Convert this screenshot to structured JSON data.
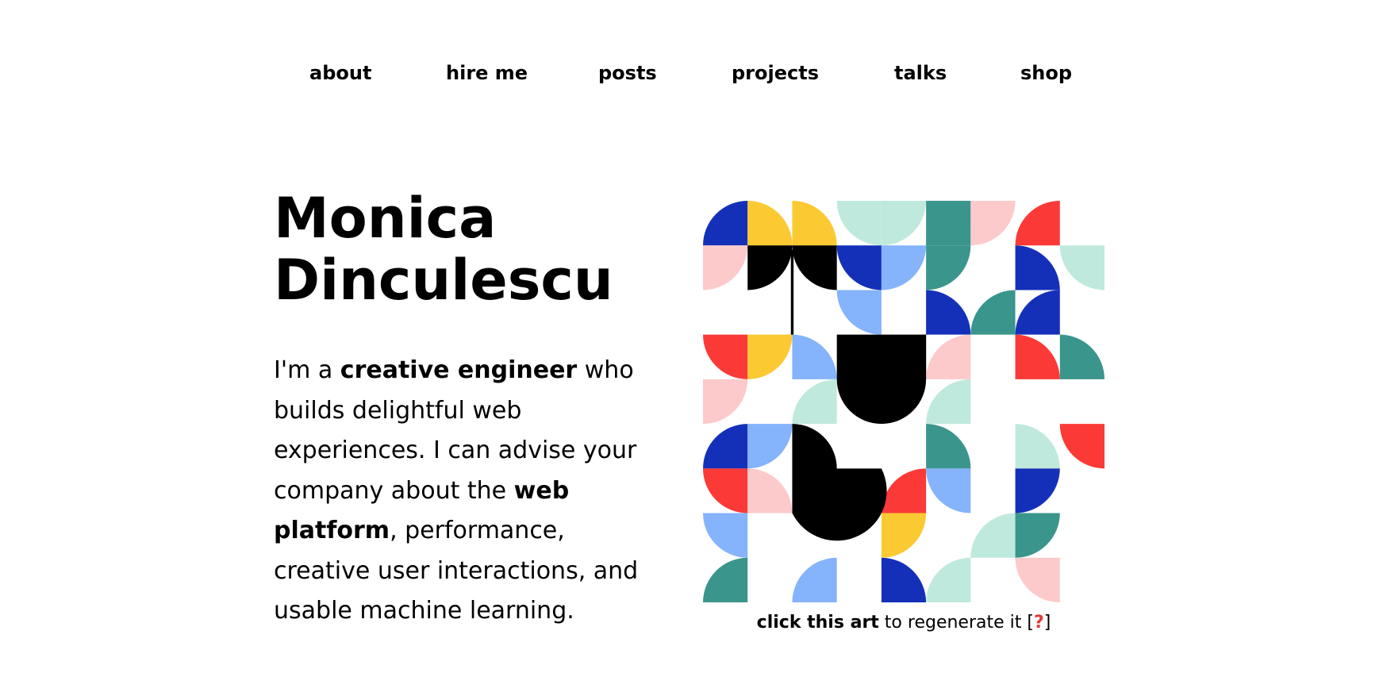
{
  "nav": {
    "items": [
      {
        "label": "about"
      },
      {
        "label": "hire me"
      },
      {
        "label": "posts"
      },
      {
        "label": "projects"
      },
      {
        "label": "talks"
      },
      {
        "label": "shop"
      }
    ]
  },
  "hero": {
    "name_line1": "Monica",
    "name_line2": "Dinculescu",
    "intro": {
      "t1": "I'm a ",
      "b1": "creative engineer",
      "t2": " who builds delightful web experiences. I can advise your company about the ",
      "b2": "web platform",
      "t3": ", performance, creative user interactions, and usable machine learning."
    }
  },
  "art": {
    "palette": {
      "blue": "#1530b8",
      "yellow": "#fbc932",
      "mint": "#c0e9dd",
      "teal": "#3a958c",
      "pink": "#fdcacb",
      "red": "#fb3a37",
      "lightblue": "#85b3fc",
      "black": "#000000"
    },
    "caption_bold": "click this art",
    "caption_rest": " to regenerate it [",
    "caption_help": "?",
    "caption_end": "]"
  }
}
